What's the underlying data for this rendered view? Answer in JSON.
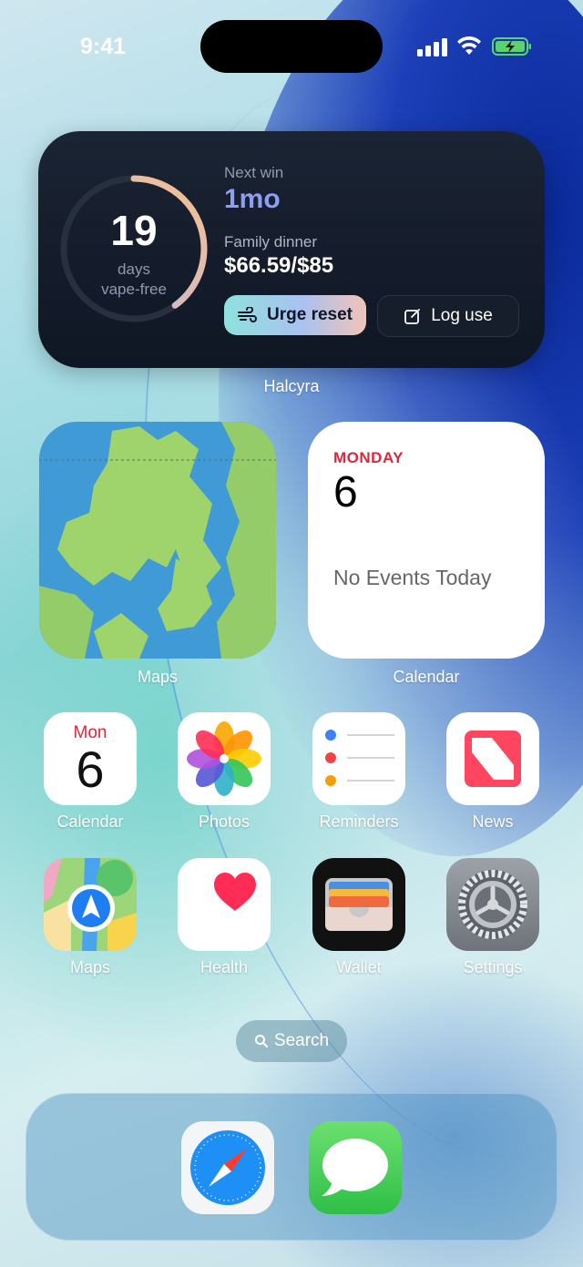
{
  "status_bar": {
    "time": "9:41"
  },
  "halcyra_widget": {
    "streak_days": "19",
    "streak_label_1": "days",
    "streak_label_2": "vape-free",
    "streak_progress": 0.4,
    "next_win_label": "Next win",
    "next_win_value": "1mo",
    "goal_label": "Family dinner",
    "goal_value": "$66.59/$85",
    "urge_reset_label": "Urge reset",
    "log_use_label": "Log use",
    "caption": "Halcyra",
    "colors": {
      "accent": "#8f9ef2",
      "background": "#141c2a"
    }
  },
  "maps_widget": {
    "caption": "Maps"
  },
  "calendar_widget": {
    "weekday": "MONDAY",
    "date": "6",
    "events_text": "No Events Today",
    "caption": "Calendar"
  },
  "apps": [
    {
      "label": "Calendar",
      "icon": "calendar-icon",
      "month": "Mon",
      "day": "6"
    },
    {
      "label": "Photos",
      "icon": "photos-icon"
    },
    {
      "label": "Reminders",
      "icon": "reminders-icon"
    },
    {
      "label": "News",
      "icon": "news-icon"
    },
    {
      "label": "Maps",
      "icon": "maps-icon"
    },
    {
      "label": "Health",
      "icon": "health-icon"
    },
    {
      "label": "Wallet",
      "icon": "wallet-icon"
    },
    {
      "label": "Settings",
      "icon": "settings-icon"
    }
  ],
  "search": {
    "label": "Search"
  },
  "dock": [
    {
      "icon": "safari-icon"
    },
    {
      "icon": "messages-icon"
    }
  ]
}
